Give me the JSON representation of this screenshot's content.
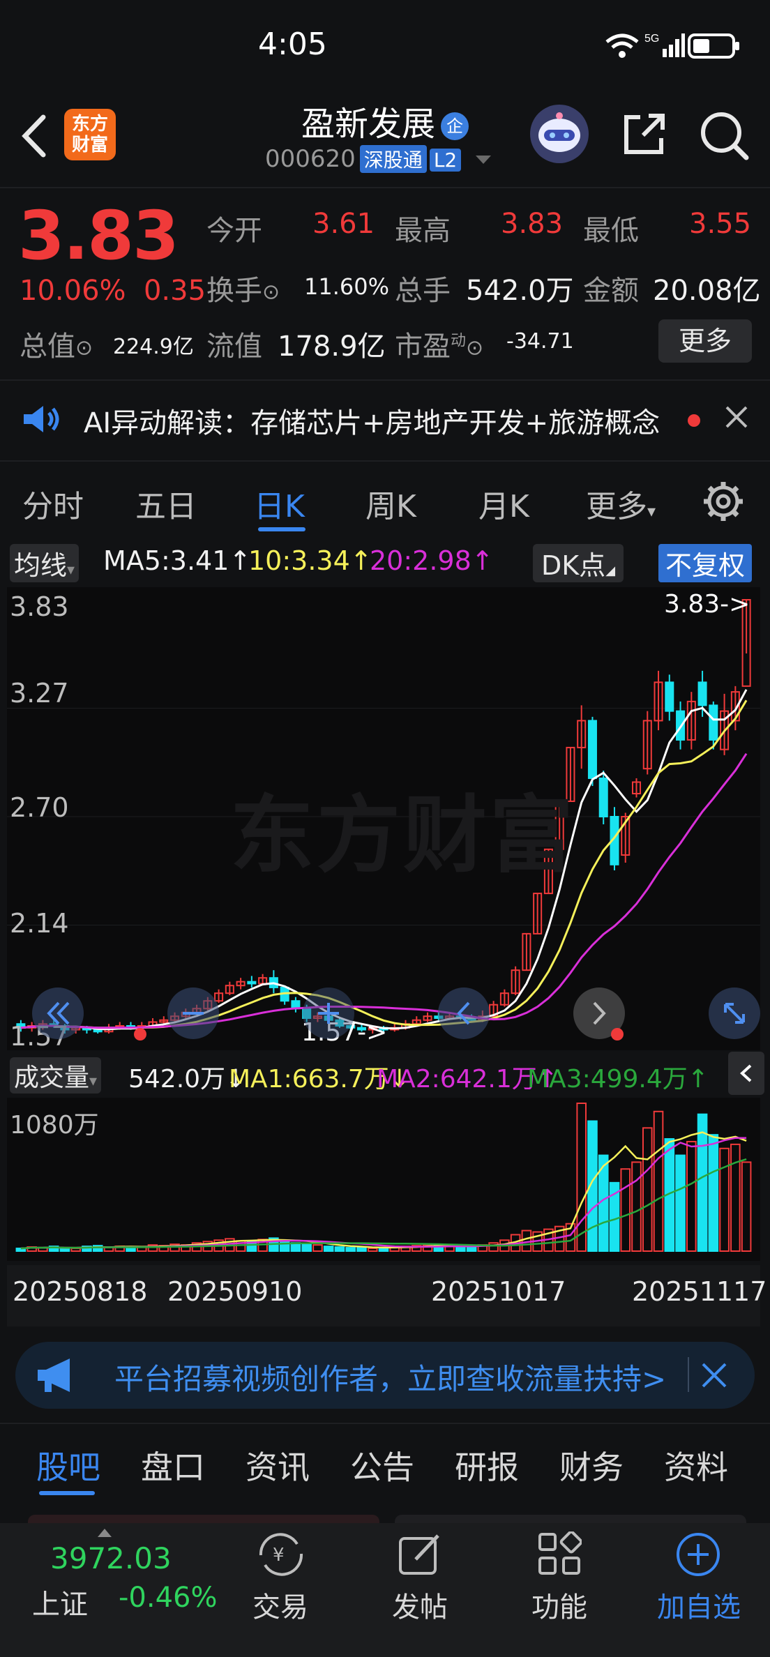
{
  "status_bar": {
    "time": "4:05",
    "battery_level": 0.45
  },
  "header": {
    "logo_text_1": "东方",
    "logo_text_2": "财富",
    "stock_name": "盈新发展",
    "badge": "企",
    "code": "000620",
    "tag_sgt": "深股通",
    "tag_l2": "L2"
  },
  "quote": {
    "price": "3.83",
    "change_pct": "10.06%",
    "change_amt": "0.35",
    "open_label": "今开",
    "open": "3.61",
    "high_label": "最高",
    "high": "3.83",
    "low_label": "最低",
    "low": "3.55",
    "turnover_label": "换手",
    "turnover": "11.60%",
    "volume_label": "总手",
    "volume": "542.0万",
    "amount_label": "金额",
    "amount": "20.08亿",
    "mktcap_label": "总值",
    "mktcap": "224.9亿",
    "float_label": "流值",
    "float": "178.9亿",
    "pe_label": "市盈",
    "pe_super": "动",
    "pe": "-34.71",
    "more": "更多"
  },
  "ai_bar": {
    "text": "AI异动解读：存储芯片+房地产开发+旅游概念"
  },
  "chart_tabs": [
    "分时",
    "五日",
    "日K",
    "周K",
    "月K",
    "更多"
  ],
  "ma_row": {
    "dropdown": "均线",
    "ma5": "MA5:3.41↑",
    "ma10": "10:3.34↑",
    "ma20": "20:2.98↑",
    "dk": "DK点",
    "fq": "不复权"
  },
  "vol_row": {
    "dropdown": "成交量",
    "vol": "542.0万↓",
    "ma1": "MA1:663.7万↓",
    "ma2": "MA2:642.1万↑",
    "ma3": "MA3:499.4万↑"
  },
  "colors": {
    "up": "#f03a3a",
    "down": "#19e3f0",
    "ma5": "#ffffff",
    "ma10": "#f5f05a",
    "ma20": "#d92fd9",
    "accent": "#3a86f0"
  },
  "chart_data": {
    "type": "candlestick",
    "y_labels": [
      "3.83",
      "3.27",
      "2.70",
      "2.14",
      "1.57"
    ],
    "ylim": [
      1.57,
      3.83
    ],
    "max_annotation": "3.83->",
    "min_annotation": "1.57->",
    "watermark": "东方财富",
    "vol_label": "1080万",
    "x_labels": [
      "20250818",
      "20250910",
      "20251017",
      "20251117"
    ],
    "candles": [
      [
        1.62,
        1.6,
        1.64,
        1.58
      ],
      [
        1.6,
        1.61,
        1.63,
        1.58
      ],
      [
        1.61,
        1.62,
        1.64,
        1.59
      ],
      [
        1.62,
        1.61,
        1.64,
        1.6
      ],
      [
        1.61,
        1.59,
        1.62,
        1.57
      ],
      [
        1.59,
        1.6,
        1.61,
        1.57
      ],
      [
        1.6,
        1.59,
        1.61,
        1.57
      ],
      [
        1.59,
        1.58,
        1.6,
        1.57
      ],
      [
        1.58,
        1.6,
        1.62,
        1.57
      ],
      [
        1.6,
        1.61,
        1.63,
        1.59
      ],
      [
        1.61,
        1.6,
        1.63,
        1.59
      ],
      [
        1.6,
        1.61,
        1.63,
        1.59
      ],
      [
        1.61,
        1.63,
        1.65,
        1.6
      ],
      [
        1.63,
        1.64,
        1.66,
        1.62
      ],
      [
        1.64,
        1.66,
        1.68,
        1.63
      ],
      [
        1.66,
        1.68,
        1.7,
        1.65
      ],
      [
        1.68,
        1.7,
        1.72,
        1.67
      ],
      [
        1.7,
        1.74,
        1.76,
        1.69
      ],
      [
        1.74,
        1.78,
        1.8,
        1.73
      ],
      [
        1.78,
        1.82,
        1.84,
        1.77
      ],
      [
        1.82,
        1.84,
        1.86,
        1.8
      ],
      [
        1.84,
        1.83,
        1.87,
        1.81
      ],
      [
        1.83,
        1.86,
        1.88,
        1.82
      ],
      [
        1.86,
        1.81,
        1.9,
        1.78
      ],
      [
        1.81,
        1.74,
        1.82,
        1.72
      ],
      [
        1.74,
        1.7,
        1.76,
        1.68
      ],
      [
        1.7,
        1.65,
        1.72,
        1.63
      ],
      [
        1.65,
        1.66,
        1.68,
        1.63
      ],
      [
        1.66,
        1.64,
        1.67,
        1.62
      ],
      [
        1.64,
        1.61,
        1.65,
        1.6
      ],
      [
        1.61,
        1.6,
        1.63,
        1.58
      ],
      [
        1.6,
        1.59,
        1.62,
        1.58
      ],
      [
        1.59,
        1.6,
        1.61,
        1.57
      ],
      [
        1.6,
        1.59,
        1.61,
        1.57
      ],
      [
        1.59,
        1.6,
        1.62,
        1.58
      ],
      [
        1.6,
        1.62,
        1.64,
        1.59
      ],
      [
        1.62,
        1.64,
        1.66,
        1.61
      ],
      [
        1.64,
        1.66,
        1.68,
        1.63
      ],
      [
        1.66,
        1.65,
        1.68,
        1.64
      ],
      [
        1.65,
        1.66,
        1.68,
        1.64
      ],
      [
        1.66,
        1.65,
        1.67,
        1.64
      ],
      [
        1.65,
        1.64,
        1.67,
        1.63
      ],
      [
        1.64,
        1.66,
        1.69,
        1.63
      ],
      [
        1.66,
        1.72,
        1.74,
        1.65
      ],
      [
        1.72,
        1.78,
        1.8,
        1.71
      ],
      [
        1.78,
        1.9,
        1.92,
        1.77
      ],
      [
        1.9,
        2.09,
        2.09,
        1.9
      ],
      [
        2.09,
        2.3,
        2.3,
        2.09
      ],
      [
        2.3,
        2.53,
        2.53,
        2.3
      ],
      [
        2.53,
        2.78,
        2.78,
        2.53
      ],
      [
        2.78,
        3.06,
        3.06,
        2.78
      ],
      [
        3.06,
        3.2,
        3.28,
        2.95
      ],
      [
        3.2,
        2.9,
        3.22,
        2.86
      ],
      [
        2.9,
        2.7,
        2.94,
        2.66
      ],
      [
        2.7,
        2.45,
        2.75,
        2.42
      ],
      [
        2.5,
        2.7,
        2.72,
        2.46
      ],
      [
        2.82,
        2.88,
        2.9,
        2.8
      ],
      [
        2.95,
        3.2,
        3.25,
        2.92
      ],
      [
        3.2,
        3.4,
        3.46,
        3.15
      ],
      [
        3.4,
        3.25,
        3.44,
        3.2
      ],
      [
        3.25,
        3.1,
        3.3,
        3.05
      ],
      [
        3.1,
        3.3,
        3.35,
        3.05
      ],
      [
        3.4,
        3.28,
        3.46,
        3.22
      ],
      [
        3.28,
        3.1,
        3.3,
        3.05
      ],
      [
        3.05,
        3.25,
        3.34,
        3.02
      ],
      [
        3.2,
        3.35,
        3.38,
        3.15
      ],
      [
        3.38,
        3.83,
        3.83,
        3.55
      ]
    ],
    "volumes": [
      20,
      30,
      25,
      35,
      15,
      20,
      35,
      40,
      30,
      35,
      25,
      30,
      45,
      40,
      50,
      45,
      60,
      70,
      80,
      90,
      75,
      70,
      85,
      95,
      80,
      60,
      50,
      45,
      35,
      30,
      25,
      30,
      20,
      25,
      30,
      35,
      40,
      45,
      50,
      40,
      35,
      30,
      45,
      60,
      80,
      120,
      150,
      140,
      160,
      180,
      200,
      1080,
      950,
      700,
      500,
      600,
      650,
      900,
      1020,
      820,
      700,
      800,
      1000,
      850,
      750,
      780,
      650
    ]
  },
  "banner": {
    "text": "平台招募视频创作者，立即查收流量扶持>"
  },
  "bottom_tabs": [
    "股吧",
    "盘口",
    "资讯",
    "公告",
    "研报",
    "财务",
    "资料"
  ],
  "bottom_nav": {
    "index_value": "3972.03",
    "index_name": "上证",
    "index_change": "-0.46%",
    "trade": "交易",
    "post": "发帖",
    "func": "功能",
    "add": "加自选"
  }
}
